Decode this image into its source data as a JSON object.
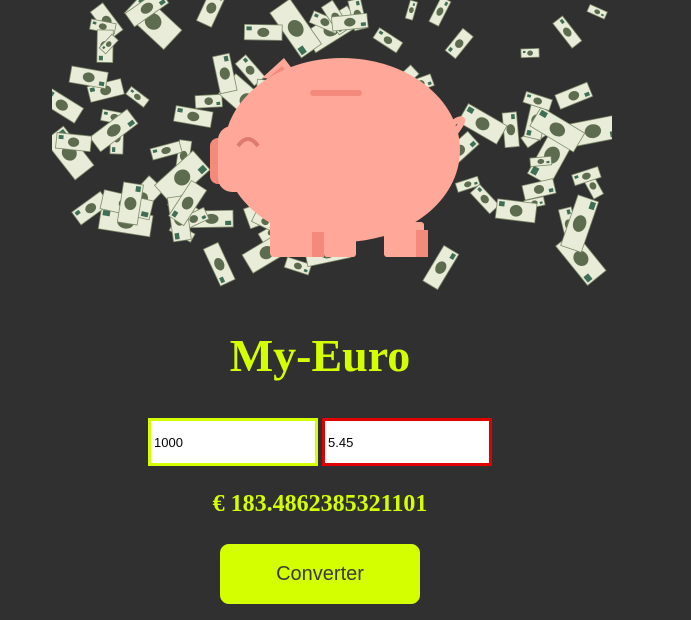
{
  "app": {
    "title": "My-Euro"
  },
  "form": {
    "amount_value": "1000",
    "rate_value": "5.45"
  },
  "result": {
    "text": "€ 183.4862385321101"
  },
  "actions": {
    "convert_label": "Converter"
  },
  "hero": {
    "image": "piggy-bank-with-falling-money-image"
  },
  "colors": {
    "background": "#303030",
    "accent": "#d4ff00",
    "amount_border": "#d4ff00",
    "rate_border": "#e00000",
    "piggy": "#ffa89a",
    "piggy_dark": "#f48a7c",
    "banknote": "#e9ecd8"
  }
}
